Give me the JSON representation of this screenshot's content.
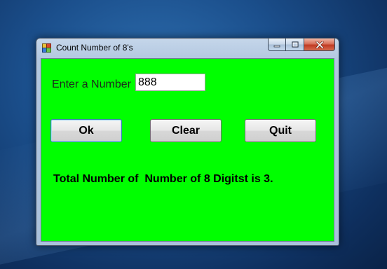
{
  "window": {
    "title": "Count Number of 8's"
  },
  "form": {
    "input_label": "Enter a Number",
    "input_value": "888"
  },
  "buttons": {
    "ok_label": "Ok",
    "clear_label": "Clear",
    "quit_label": "Quit"
  },
  "result": {
    "text": "Total Number of  Number of 8 Digitst is 3."
  },
  "icons": {
    "app": "app-icon",
    "minimize": "minimize-icon",
    "maximize": "maximize-icon",
    "close": "close-icon"
  },
  "colors": {
    "client_background": "#00ff00",
    "close_button": "#c13b24"
  }
}
